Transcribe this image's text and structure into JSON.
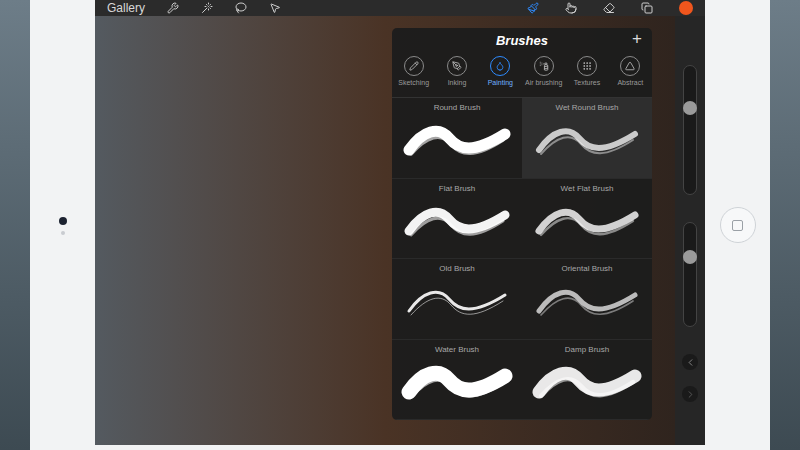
{
  "toolbar": {
    "gallery": "Gallery",
    "left_tools": [
      {
        "selected": false
      },
      {
        "selected": false
      },
      {
        "selected": false
      },
      {
        "selected": false
      }
    ],
    "right_tools": [
      {
        "selected": true
      },
      {
        "selected": false
      },
      {
        "selected": false
      },
      {
        "selected": false
      }
    ],
    "color": "#f0561d"
  },
  "brushes_panel": {
    "title": "Brushes",
    "add": "+",
    "categories": [
      {
        "label": "Sketching",
        "selected": false
      },
      {
        "label": "Inking",
        "selected": false
      },
      {
        "label": "Painting",
        "selected": true
      },
      {
        "label": "Air brushing",
        "selected": false
      },
      {
        "label": "Textures",
        "selected": false
      },
      {
        "label": "Abstract",
        "selected": false
      }
    ],
    "brushes": [
      {
        "name": "Round Brush",
        "selected": false
      },
      {
        "name": "Wet Round Brush",
        "selected": true
      },
      {
        "name": "Flat Brush",
        "selected": false
      },
      {
        "name": "Wet Flat Brush",
        "selected": false
      },
      {
        "name": "Old Brush",
        "selected": false
      },
      {
        "name": "Oriental Brush",
        "selected": false
      },
      {
        "name": "Water Brush",
        "selected": false
      },
      {
        "name": "Damp Brush",
        "selected": false
      }
    ]
  },
  "side_sliders": [
    {
      "level": 0.7
    },
    {
      "level": 0.7
    }
  ]
}
